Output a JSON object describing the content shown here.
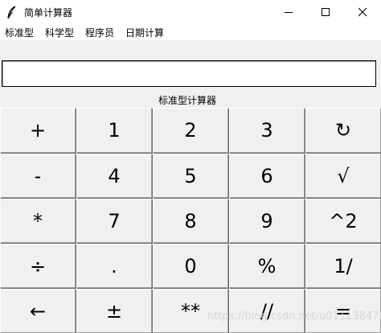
{
  "window": {
    "title": "简单计算器",
    "icon": "feather-icon",
    "controls": [
      "minimize-icon",
      "maximize-icon",
      "close-icon"
    ]
  },
  "menu": {
    "items": [
      {
        "label": "标准型"
      },
      {
        "label": "科学型"
      },
      {
        "label": "程序员"
      },
      {
        "label": "日期计算"
      }
    ]
  },
  "display": {
    "value": ""
  },
  "mode_label": "标准型计算器",
  "keypad": {
    "rows": [
      [
        "+",
        "1",
        "2",
        "3",
        "↻"
      ],
      [
        "-",
        "4",
        "5",
        "6",
        "√"
      ],
      [
        "*",
        "7",
        "8",
        "9",
        "^2"
      ],
      [
        "÷",
        ".",
        "0",
        "%",
        "1/"
      ],
      [
        "←",
        "±",
        "**",
        "//",
        "="
      ]
    ]
  },
  "watermark": "https://blog.csdn.net/u011138476"
}
